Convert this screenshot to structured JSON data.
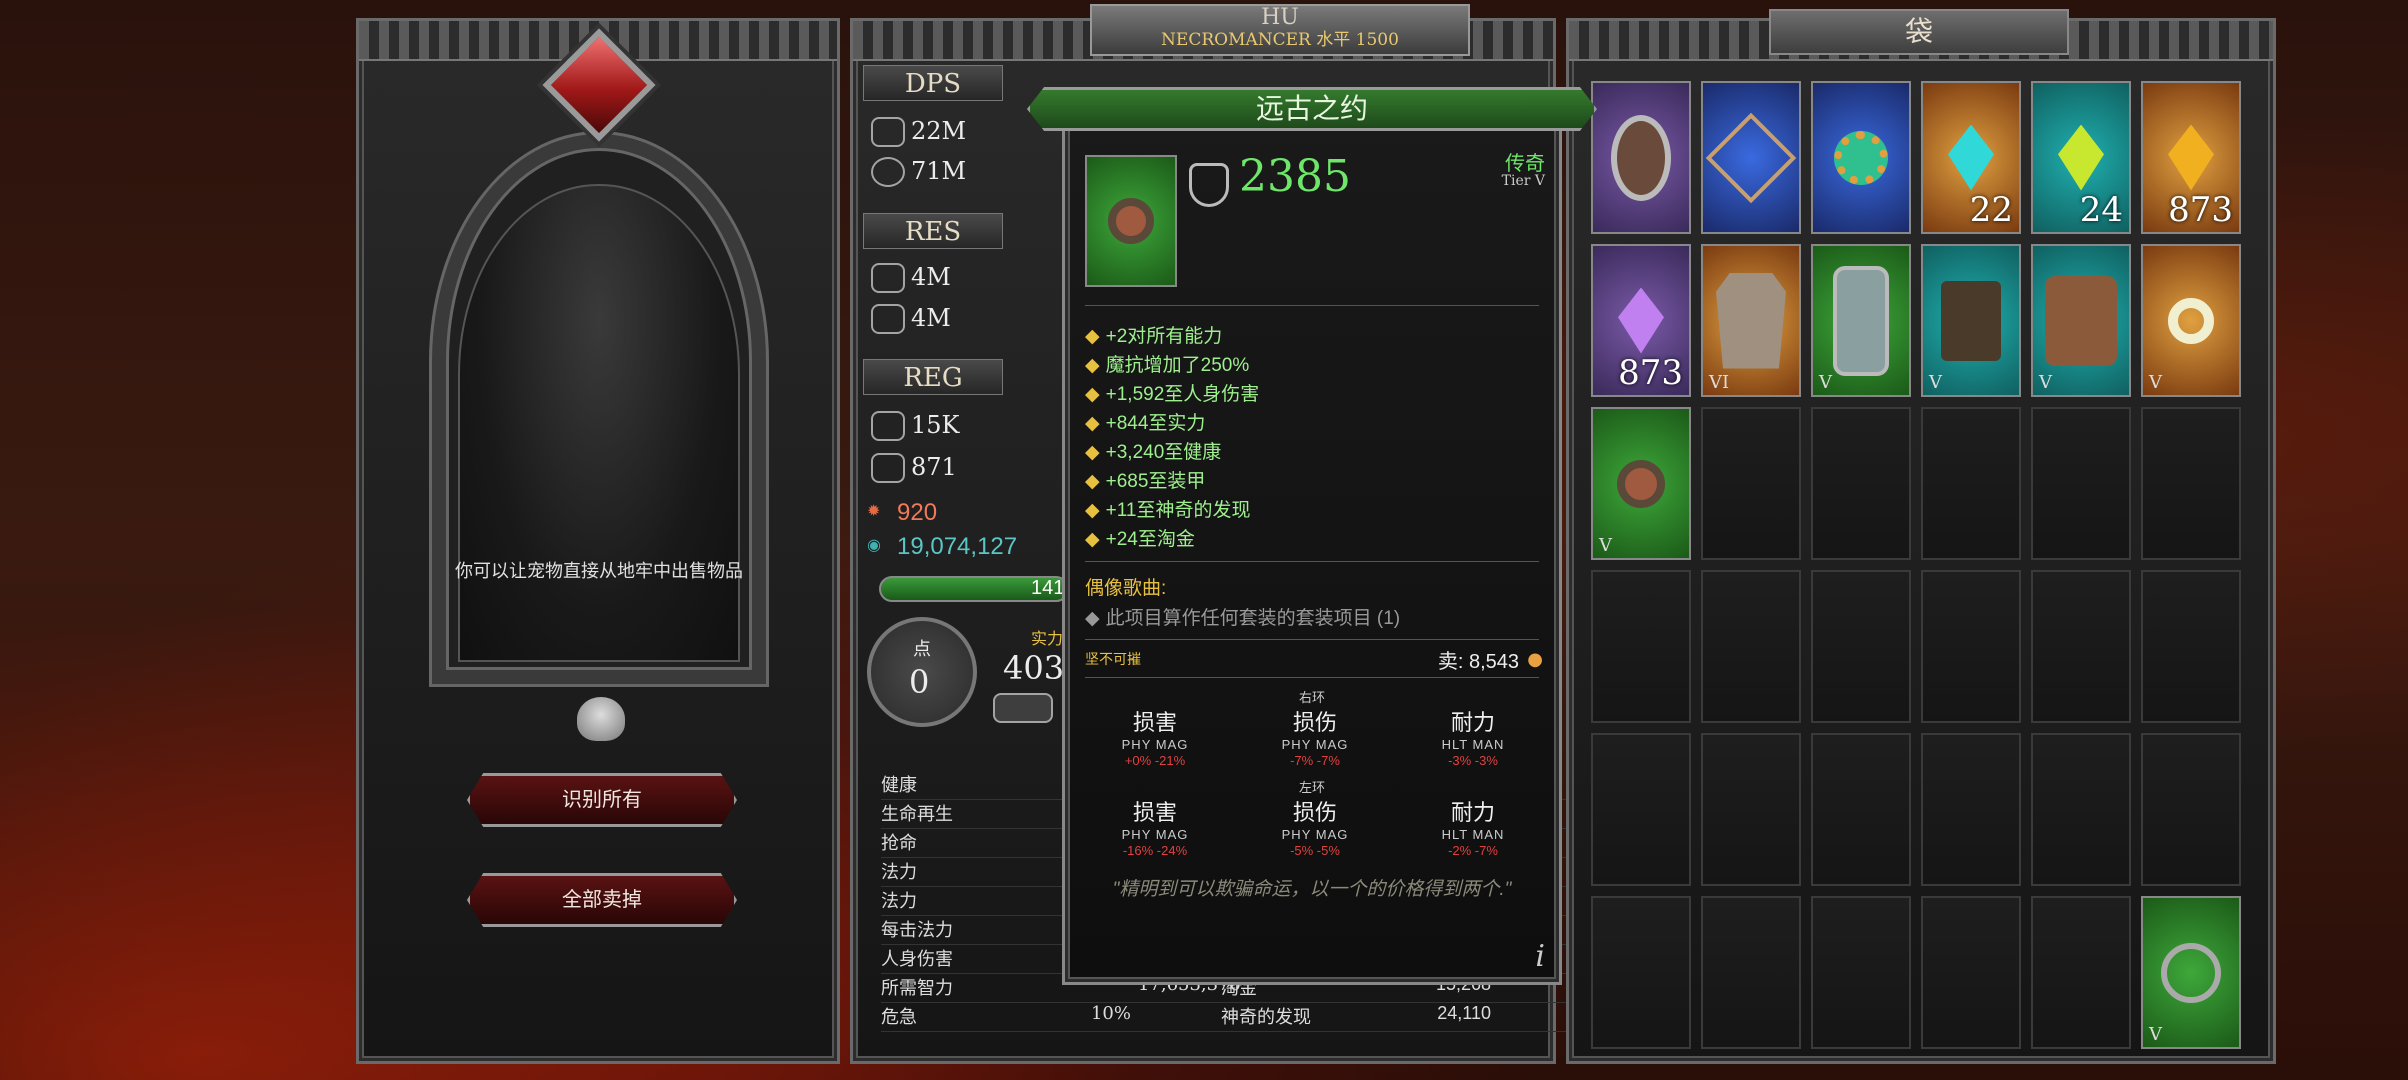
{
  "character": {
    "name": "HU",
    "class_level": "NECROMANCER 水平 1500"
  },
  "left_panel": {
    "hint": "你可以让宠物直接从地牢中出售物品",
    "identify_all": "识别所有",
    "sell_all": "全部卖掉"
  },
  "stats": {
    "dps_label": "DPS",
    "dps_phys": "22M",
    "dps_mag": "71M",
    "res_label": "RES",
    "res_phys": "4M",
    "res_mag": "4M",
    "reg_label": "REG",
    "reg_life": "15K",
    "reg_mana": "871",
    "gold_like": "920",
    "currency": "19,074,127",
    "bar_value": "141",
    "points_label": "点",
    "points_value": "0",
    "strength_label": "实力",
    "strength_value": "403",
    "rows_left": [
      "健康",
      "生命再生",
      "抢命",
      "法力",
      "法力",
      "每击法力",
      "人身伤害",
      "所需智力",
      "危急"
    ],
    "row_value_required_int": "17,653,370",
    "row_value_crit": "10%",
    "rows_right": [
      {
        "label": "淘金",
        "value": "15,268"
      },
      {
        "label": "神奇的发现",
        "value": "24,110"
      }
    ]
  },
  "tooltip": {
    "title": "远古之约",
    "armor": "2385",
    "rarity": "传奇",
    "tier": "Tier V",
    "affixes": [
      "+2对所有能力",
      "魔抗增加了250%",
      "+1,592至人身伤害",
      "+844至实力",
      "+3,240至健康",
      "+685至装甲",
      "+11至神奇的发现",
      "+24至淘金"
    ],
    "idol_label": "偶像歌曲:",
    "idol_text": "此项目算作任何套装的套装项目 (1)",
    "unbreakable": "坚不可摧",
    "sell_label": "卖: 8,543",
    "right_ring": "右环",
    "left_ring": "左环",
    "cmp_headers": [
      "损害",
      "损伤",
      "耐力"
    ],
    "cmp_sub": [
      "PHY MAG",
      "PHY MAG",
      "HLT MAN"
    ],
    "right_vals": [
      "+0% -21%",
      "-7% -7%",
      "-3% -3%"
    ],
    "left_vals": [
      "-16% -24%",
      "-5% -5%",
      "-2% -7%"
    ],
    "quote": "\"精明到可以欺骗命运，以一个的价格得到两个.\"",
    "info": "i"
  },
  "bag": {
    "title": "袋",
    "counts": [
      "22",
      "24",
      "873",
      "873"
    ],
    "tiers": [
      "VI",
      "V",
      "V",
      "V",
      "V",
      "V",
      "V"
    ]
  },
  "colors": {
    "legendary_green": "#3ea83a",
    "affix_green": "#9ef08e",
    "gold": "#e8c040",
    "red": "#e24040"
  }
}
